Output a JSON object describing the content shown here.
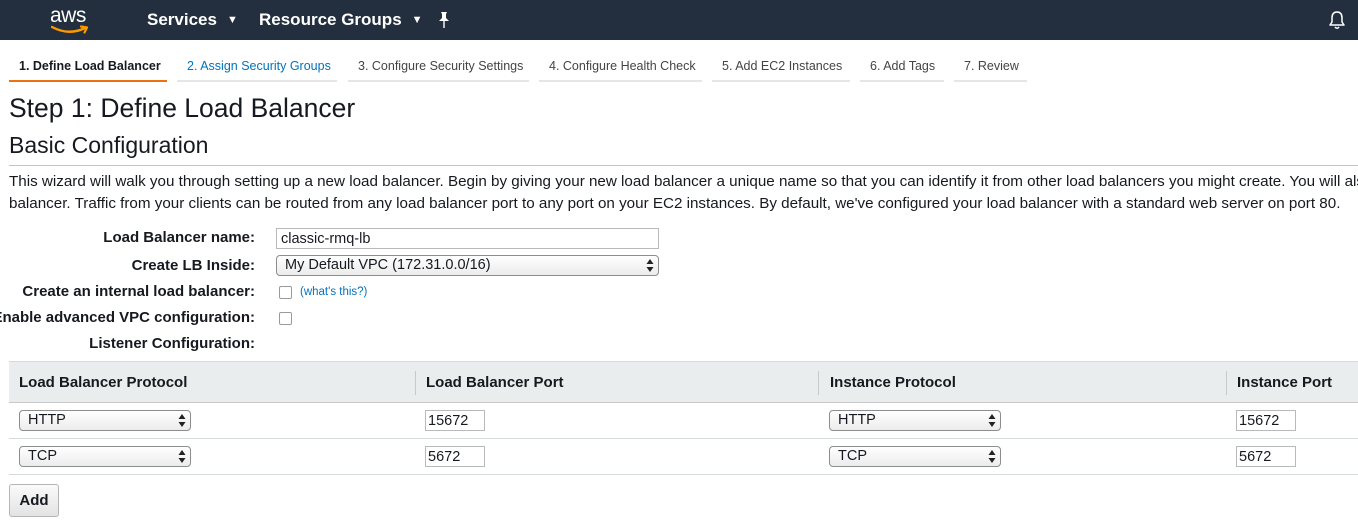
{
  "header": {
    "logo_text": "aws",
    "nav": [
      {
        "label": "Services"
      },
      {
        "label": "Resource Groups"
      }
    ]
  },
  "wizard": {
    "tabs": [
      {
        "label": "1. Define Load Balancer",
        "state": "active"
      },
      {
        "label": "2. Assign Security Groups",
        "state": "link"
      },
      {
        "label": "3. Configure Security Settings",
        "state": "default"
      },
      {
        "label": "4. Configure Health Check",
        "state": "default"
      },
      {
        "label": "5. Add EC2 Instances",
        "state": "default"
      },
      {
        "label": "6. Add Tags",
        "state": "default"
      },
      {
        "label": "7. Review",
        "state": "default"
      }
    ]
  },
  "page": {
    "title": "Step 1: Define Load Balancer",
    "section_title": "Basic Configuration",
    "description_line1": "This wizard will walk you through setting up a new load balancer. Begin by giving your new load balancer a unique name so that you can identify it from other load balancers you might create. You will also need to co",
    "description_line2": "balancer. Traffic from your clients can be routed from any load balancer port to any port on your EC2 instances. By default, we've configured your load balancer with a standard web server on port 80."
  },
  "form": {
    "name_label": "Load Balancer name:",
    "name_value": "classic-rmq-lb",
    "inside_label": "Create LB Inside:",
    "inside_value": "My Default VPC (172.31.0.0/16)",
    "internal_label": "Create an internal load balancer:",
    "internal_checked": false,
    "internal_help": "(what's this?)",
    "advanced_label": "Enable advanced VPC configuration:",
    "advanced_checked": false,
    "listener_label": "Listener Configuration:"
  },
  "listeners": {
    "columns": [
      "Load Balancer Protocol",
      "Load Balancer Port",
      "Instance Protocol",
      "Instance Port"
    ],
    "rows": [
      {
        "lb_protocol": "HTTP",
        "lb_port": "15672",
        "instance_protocol": "HTTP",
        "instance_port": "15672"
      },
      {
        "lb_protocol": "TCP",
        "lb_port": "5672",
        "instance_protocol": "TCP",
        "instance_port": "5672"
      }
    ],
    "add_label": "Add"
  },
  "colors": {
    "nav_bg": "#232f3e",
    "active_tab_accent": "#ec7211",
    "link": "#0073bb",
    "logo_smile": "#ff9900"
  },
  "icons": {
    "services_chevron": "chevron-down-icon",
    "resource_groups_chevron": "chevron-down-icon",
    "pin": "pin-icon",
    "notifications": "bell-icon",
    "select_arrows": "updown-arrows-icon"
  }
}
